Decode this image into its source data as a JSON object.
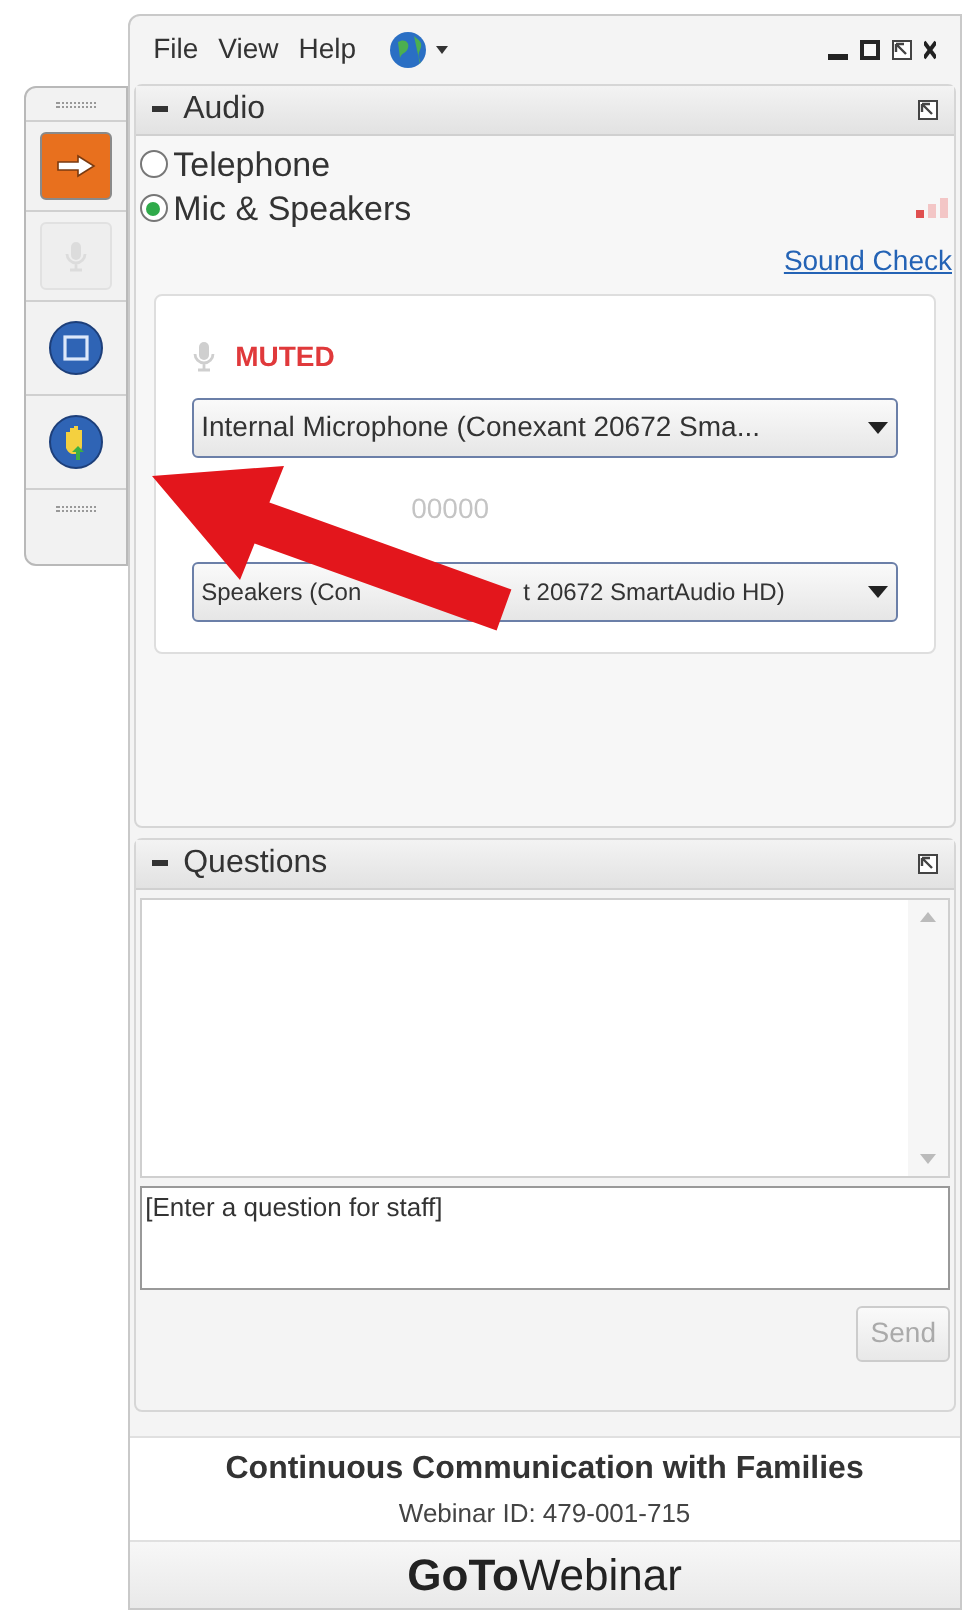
{
  "menu": [
    "File",
    "View",
    "Help"
  ],
  "toolbar": [
    {
      "kind": "arrow",
      "disabled": false
    },
    {
      "kind": "mic",
      "disabled": true
    },
    {
      "kind": "screen",
      "disabled": false
    },
    {
      "kind": "hand",
      "disabled": false
    }
  ],
  "audio": {
    "title": "Audio",
    "options": [
      {
        "label": "Telephone",
        "selected": false
      },
      {
        "label": "Mic & Speakers",
        "selected": true
      }
    ],
    "sound_check": "Sound Check",
    "mic_status": "MUTED",
    "microphone": "Internal Microphone (Conexant 20672 Sma...",
    "meter_text": "00000",
    "speakers_left": "Speakers (Con",
    "speakers_right": "t 20672 SmartAudio HD)"
  },
  "questions": {
    "title": "Questions",
    "placeholder": "[Enter a question for staff]",
    "send": "Send"
  },
  "footer": {
    "title": "Continuous Communication with Families",
    "webinar_id": "Webinar ID: 479-001-715",
    "brand_bold": "GoTo",
    "brand_light": "Webinar"
  }
}
